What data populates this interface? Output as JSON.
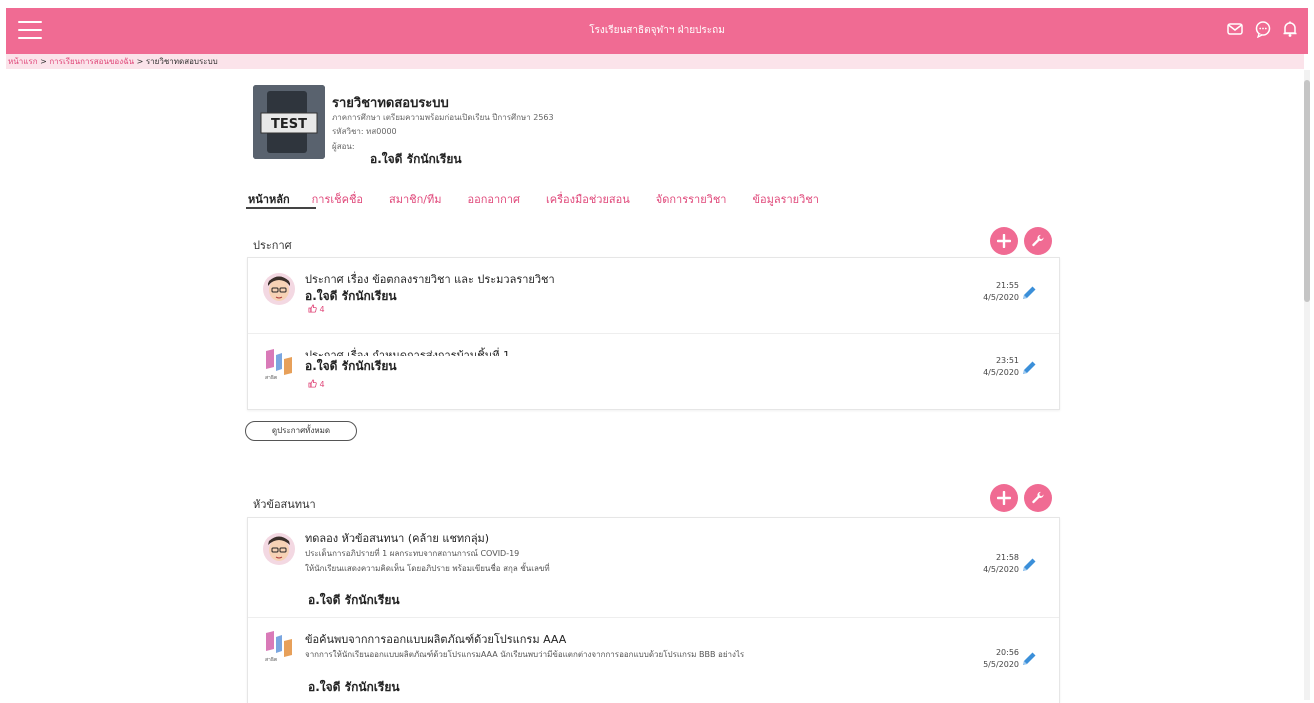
{
  "header": {
    "title": "โรงเรียนสาธิตจุฬาฯ ฝ่ายประถม",
    "menu_icon": "hamburger-icon",
    "icons": [
      "mail-icon",
      "chat-icon",
      "bell-icon"
    ]
  },
  "breadcrumb": {
    "home": "หน้าแรก",
    "sep1": ">",
    "parent": "การเรียนการสอนของฉัน",
    "sep2": ">",
    "current": "รายวิชาทดสอบระบบ"
  },
  "course": {
    "thumb_text": "TEST",
    "title": "รายวิชาทดสอบระบบ",
    "term": "ภาคการศึกษา เตรียมความพร้อมก่อนเปิดเรียน ปีการศึกษา 2563",
    "code": "รหัสวิชา: ทส0000",
    "teacher_label": "ผู้สอน:",
    "teacher": "อ.ใจดี รักนักเรียน"
  },
  "tabs": [
    "หน้าหลัก",
    "การเช็คชื่อ",
    "สมาชิก/ทีม",
    "ออกอากาศ",
    "เครื่องมือช่วยสอน",
    "จัดการรายวิชา",
    "ข้อมูลรายวิชา"
  ],
  "announcements": {
    "title": "ประกาศ",
    "items": [
      {
        "title": "ประกาศ เรื่อง ข้อตกลงรายวิชา และ ประมวลรายวิชา",
        "author": "อ.ใจดี รักนักเรียน",
        "likes": "4",
        "time": "21:55",
        "date": "4/5/2020",
        "avatar": "cartoon-avatar"
      },
      {
        "title": "ประกาศ เรื่อง กำหนดการส่งการบ้านชิ้นที่ 1",
        "author": "อ.ใจดี รักนักเรียน",
        "likes": "4",
        "time": "23:51",
        "date": "4/5/2020",
        "avatar": "school-logo-avatar"
      }
    ],
    "view_all": "ดูประกาศทั้งหมด"
  },
  "discussions": {
    "title": "หัวข้อสนทนา",
    "items": [
      {
        "title": "ทดลอง หัวข้อสนทนา (คล้าย แชทกลุ่ม)",
        "desc1": "ประเด็นการอภิปรายที่ 1 ผลกระทบจากสถานการณ์ COVID-19",
        "desc2": "ให้นักเรียนแสดงความคิดเห็น โดยอภิปราย พร้อมเขียนชื่อ สกุล ชั้นเลขที่",
        "author": "อ.ใจดี รักนักเรียน",
        "time": "21:58",
        "date": "4/5/2020",
        "avatar": "cartoon-avatar"
      },
      {
        "title": "ข้อค้นพบจากการออกแบบผลิตภัณฑ์ด้วยโปรแกรม AAA",
        "desc1": "จากการให้นักเรียนออกแบบผลิตภัณฑ์ด้วยโปรแกรมAAA นักเรียนพบว่ามีข้อแตกต่างจากการออกแบบด้วยโปรแกรม BBB อย่างไร",
        "author": "อ.ใจดี รักนักเรียน",
        "time": "20:56",
        "date": "5/5/2020",
        "avatar": "school-logo-avatar"
      }
    ]
  },
  "colors": {
    "primary": "#f06b93",
    "breadcrumb_bg": "#fbe3ea",
    "link": "#e0487a",
    "edit": "#3b8fd9"
  }
}
